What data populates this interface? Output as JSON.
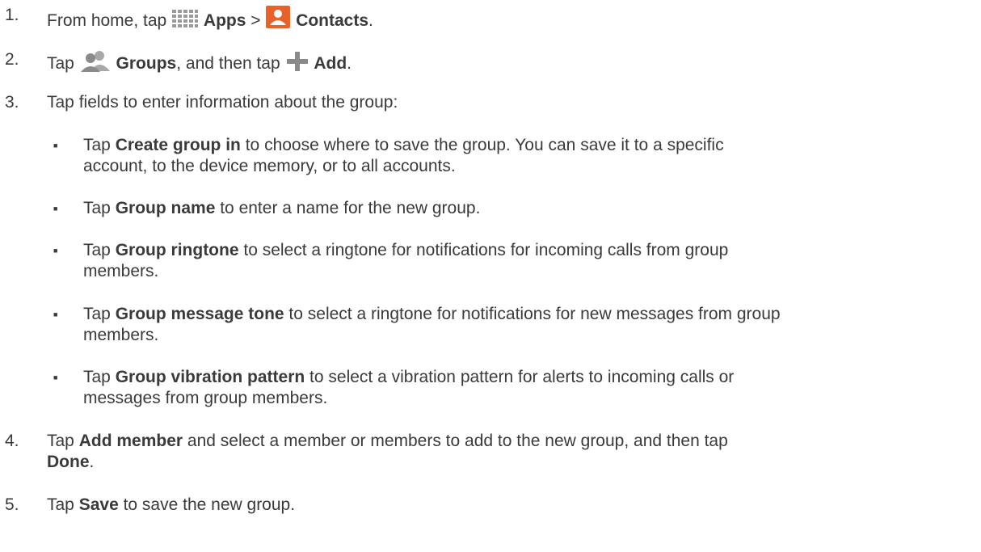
{
  "steps": [
    {
      "num": "1.",
      "t1": "From home, tap ",
      "icon1": "apps-grid-icon",
      "b1": "Apps",
      "t2": " > ",
      "icon2": "contacts-icon",
      "b2": "Contacts",
      "t3": "."
    },
    {
      "num": "2.",
      "t1": "Tap ",
      "icon1": "groups-icon",
      "b1": "Groups",
      "t2": ", and then tap ",
      "icon2": "add-plus-icon",
      "b2": "Add",
      "t3": "."
    },
    {
      "num": "3.",
      "t1": "Tap fields to enter information about the group:"
    },
    {
      "num": "4.",
      "t1": "Tap ",
      "b1": "Add member",
      "t2": " and select a member or members to add to the new group, and then tap",
      "b2": "Done",
      "t3": "."
    },
    {
      "num": "5.",
      "t1": "Tap ",
      "b1": "Save",
      "t2": " to save the new group."
    }
  ],
  "bullets": [
    {
      "t1": "Tap ",
      "b1": "Create group in",
      "t2": " to choose where to save the group. You can save it to a specific",
      "t3": "account, to the device memory, or to all accounts."
    },
    {
      "t1": "Tap ",
      "b1": "Group name",
      "t2": " to enter a name for the new group."
    },
    {
      "t1": "Tap ",
      "b1": "Group ringtone",
      "t2": " to select a ringtone for notifications for incoming calls from group",
      "t3": "members."
    },
    {
      "t1": "Tap ",
      "b1": "Group message tone",
      "t2": " to select a ringtone for notifications for new messages from group",
      "t3": "members."
    },
    {
      "t1": "Tap ",
      "b1": "Group vibration pattern",
      "t2": " to select a vibration pattern for alerts to incoming calls or",
      "t3": "messages from group members."
    }
  ],
  "bullet_char": "■",
  "colors": {
    "text": "#3a3a3a",
    "apps_icon": "#9a9a9a",
    "contacts_icon": "#e8622a",
    "groups_icon": "#8a8a8a",
    "add_icon": "#8a8a8a"
  }
}
